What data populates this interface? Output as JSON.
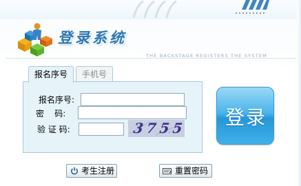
{
  "header": {
    "title": "登录系统",
    "subtitle": "THE BACKSTAGE REGISTERS THE SYSTEM"
  },
  "tabs": [
    {
      "label": "报名序号",
      "active": true
    },
    {
      "label": "手机号",
      "active": false
    }
  ],
  "form": {
    "fields": [
      {
        "label": "报名序号:",
        "value": "",
        "type": "text"
      },
      {
        "label": "密    码:",
        "value": "",
        "type": "password"
      },
      {
        "label": "验 证 码:",
        "value": "",
        "type": "text"
      }
    ],
    "captcha_text": "3755"
  },
  "buttons": {
    "login_label": "登录",
    "register_label": "考生注册",
    "reset_label": "重置密码"
  },
  "colors": {
    "accent": "#2f78b2",
    "panel_bg": "#e6f3f9",
    "login_button": "#3fb0ea"
  },
  "icons": {
    "logo": "cubes-person-logo",
    "register": "power-icon",
    "reset": "keyboard-icon"
  }
}
